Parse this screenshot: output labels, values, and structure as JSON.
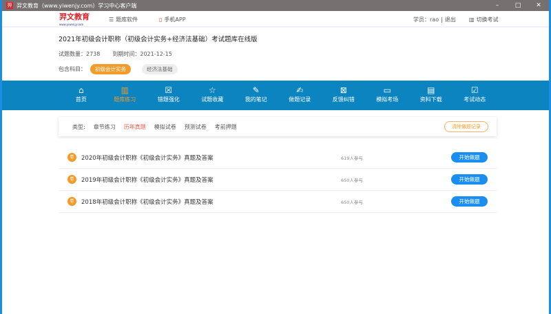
{
  "window": {
    "title": "羿文教育（www.yiwenjy.com）学习中心客户端",
    "logo_icon": "羿",
    "minimize": "–",
    "maximize": "□",
    "close": "✕"
  },
  "header": {
    "logo_text": "羿文教育",
    "logo_sub": "www.yiwenjy.com",
    "links": [
      "题库软件",
      "手机APP"
    ],
    "student_label": "学员：rao",
    "logout": "退出",
    "switch_exam": "切换考试"
  },
  "info": {
    "title": "2021年初级会计职称（初级会计实务+经济法基础）考试题库在线版",
    "count_label": "试题数量：2738",
    "expire_label": "到期时间：2021-12-15",
    "subjects_label": "包含科目：",
    "subjects": [
      {
        "label": "初级会计实务",
        "active": true
      },
      {
        "label": "经济法基础",
        "active": false
      }
    ]
  },
  "nav": {
    "accent": "#0c84bf",
    "items": [
      {
        "label": "首页",
        "icon": "home-icon",
        "glyph": "⌂"
      },
      {
        "label": "题库练习",
        "icon": "book-icon",
        "glyph": "▥",
        "active": true
      },
      {
        "label": "错题强化",
        "icon": "wrong-doc-icon",
        "glyph": "☒"
      },
      {
        "label": "试题收藏",
        "icon": "star-icon",
        "glyph": "☆"
      },
      {
        "label": "我的笔记",
        "icon": "edit-icon",
        "glyph": "✎"
      },
      {
        "label": "做题记录",
        "icon": "record-icon",
        "glyph": "✍"
      },
      {
        "label": "反馈纠错",
        "icon": "feedback-icon",
        "glyph": "⊠"
      },
      {
        "label": "模拟考场",
        "icon": "monitor-icon",
        "glyph": "▭"
      },
      {
        "label": "资料下载",
        "icon": "file-icon",
        "glyph": "▤"
      },
      {
        "label": "考试动态",
        "icon": "checklist-icon",
        "glyph": "☑"
      }
    ]
  },
  "filter": {
    "label": "类型:",
    "options": [
      {
        "label": "章节练习"
      },
      {
        "label": "历年真题",
        "active": true
      },
      {
        "label": "模拟试卷"
      },
      {
        "label": "预测试卷"
      },
      {
        "label": "考前押题"
      }
    ],
    "clear": "清除做题记录"
  },
  "list": [
    {
      "badge": "卷",
      "title": "2020年初级会计职称《初级会计实务》真题及答案",
      "count": "619人参与",
      "action": "开始做题"
    },
    {
      "badge": "卷",
      "title": "2019年初级会计职称《初级会计实务》真题及答案",
      "count": "650人参与",
      "action": "开始做题"
    },
    {
      "badge": "卷",
      "title": "2018年初级会计职称《初级会计实务》真题及答案",
      "count": "650人参与",
      "action": "开始做题"
    }
  ]
}
